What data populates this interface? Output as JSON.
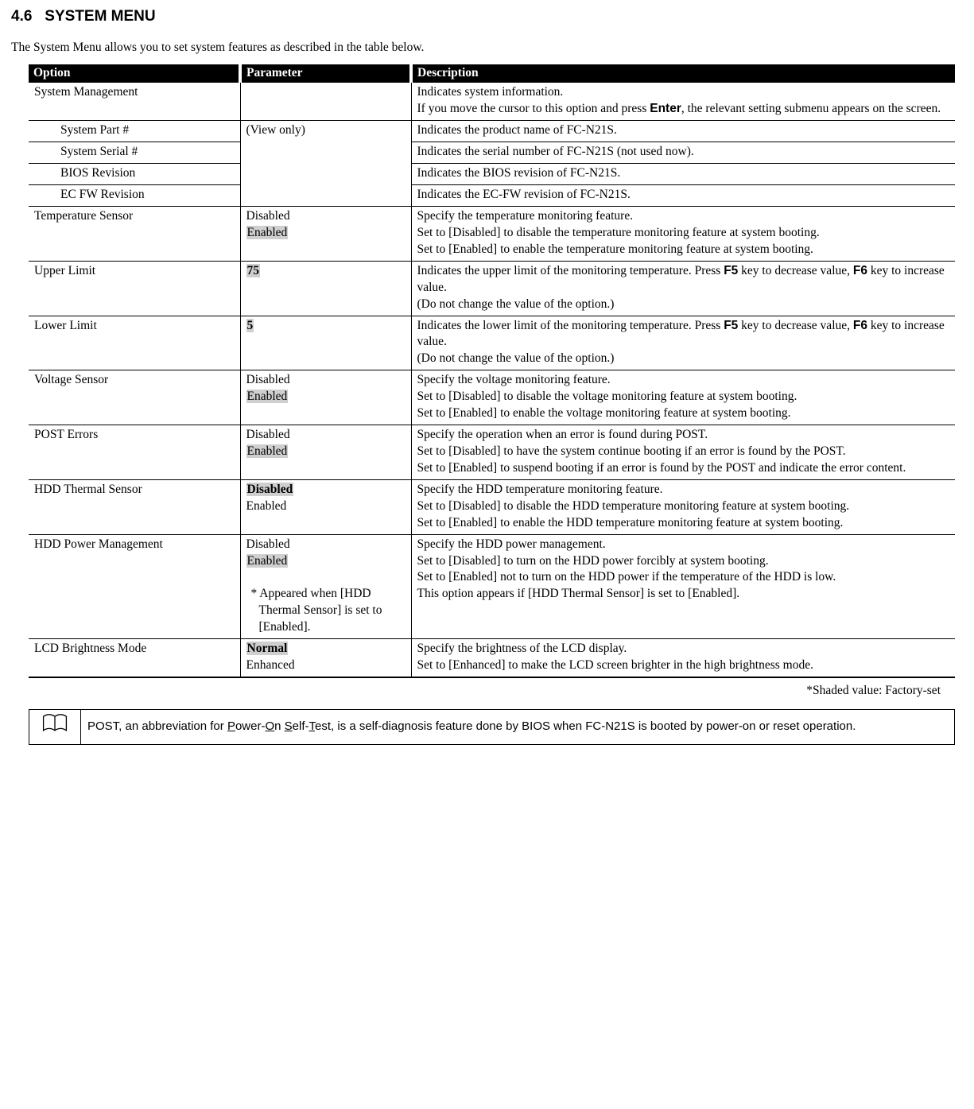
{
  "section_number": "4.6",
  "section_title": "SYSTEM MENU",
  "intro": "The System Menu allows you to set system features as described in the table below.",
  "headers": {
    "option": "Option",
    "parameter": "Parameter",
    "description": "Description"
  },
  "rows": {
    "sysmgmt": {
      "option": "System Management",
      "desc_l1": "Indicates system information.",
      "desc_l2a": "If you move the cursor to this option and press ",
      "desc_l2_key": "Enter",
      "desc_l2b": ", the relevant setting submenu appears on the screen."
    },
    "syspart": {
      "option": "System Part #",
      "param": "(View only)",
      "desc": "Indicates the product name of FC-N21S."
    },
    "sysserial": {
      "option": "System Serial #",
      "desc": "Indicates the serial number of FC-N21S (not used now)."
    },
    "biosrev": {
      "option": "BIOS Revision",
      "desc": "Indicates the BIOS revision of FC-N21S."
    },
    "ecfw": {
      "option": "EC FW Revision",
      "desc": "Indicates the EC-FW revision of FC-N21S."
    },
    "tempsensor": {
      "option": "Temperature Sensor",
      "p1": "Disabled",
      "p2": "Enabled",
      "d1": "Specify the temperature monitoring feature.",
      "d2": "Set to [Disabled] to disable the temperature monitoring feature at system booting.",
      "d3": "Set to [Enabled] to enable the temperature monitoring feature at system booting."
    },
    "upper": {
      "option": "Upper Limit",
      "p1": "75",
      "d1a": "Indicates the upper limit of the monitoring temperature. Press ",
      "d1k1": "F5",
      "d1b": " key to decrease value, ",
      "d1k2": "F6",
      "d1c": " key to increase value.",
      "d2": "(Do not change the value of the option.)"
    },
    "lower": {
      "option": "Lower Limit",
      "p1": "5",
      "d1a": "Indicates the lower limit of the monitoring temperature. Press ",
      "d1k1": "F5",
      "d1b": " key to decrease value, ",
      "d1k2": "F6",
      "d1c": " key to increase value.",
      "d2": "(Do not change the value of the option.)"
    },
    "voltage": {
      "option": "Voltage Sensor",
      "p1": "Disabled",
      "p2": "Enabled",
      "d1": "Specify the voltage monitoring feature.",
      "d2": "Set to [Disabled] to disable the voltage monitoring feature at system booting.",
      "d3": "Set to [Enabled] to enable the voltage monitoring feature at system booting."
    },
    "posterr": {
      "option": "POST Errors",
      "p1": "Disabled",
      "p2": "Enabled",
      "d1": "Specify the operation when an error is found during POST.",
      "d2": "Set to [Disabled] to have the system continue booting if an error is found by the POST.",
      "d3": "Set to [Enabled] to suspend booting if an error is found by the POST and indicate the error content."
    },
    "hddthermal": {
      "option": "HDD Thermal Sensor",
      "p1": "Disabled",
      "p2": "Enabled",
      "d1": "Specify the HDD temperature monitoring feature.",
      "d2": "Set to [Disabled] to disable the HDD temperature monitoring feature at system booting.",
      "d3": "Set to [Enabled] to enable the HDD temperature monitoring feature at system booting."
    },
    "hddpwr": {
      "option": "HDD Power Management",
      "p1": "Disabled",
      "p2": "Enabled",
      "pnote": "* Appeared when [HDD Thermal Sensor] is set to [Enabled].",
      "d1": "Specify the HDD power management.",
      "d2": "Set to [Disabled] to turn on the HDD power forcibly at system booting.",
      "d3": "Set to [Enabled] not to turn on the HDD power if the temperature of the HDD is low.",
      "d4": "This option appears if [HDD Thermal Sensor] is set to [Enabled]."
    },
    "lcd": {
      "option": "LCD Brightness Mode",
      "p1": "Normal",
      "p2": "Enhanced",
      "d1": "Specify the brightness of the LCD display.",
      "d2": "Set to [Enhanced] to make the LCD screen brighter in the high brightness mode."
    }
  },
  "footnote": "*Shaded value: Factory-set",
  "note": {
    "t1": "POST, an abbreviation for ",
    "u1": "P",
    "t2": "ower-",
    "u2": "O",
    "t3": "n ",
    "u3": "S",
    "t4": "elf-",
    "u4": "T",
    "t5": "est, is a self-diagnosis feature done by BIOS when FC-N21S is booted by power-on or reset operation."
  }
}
